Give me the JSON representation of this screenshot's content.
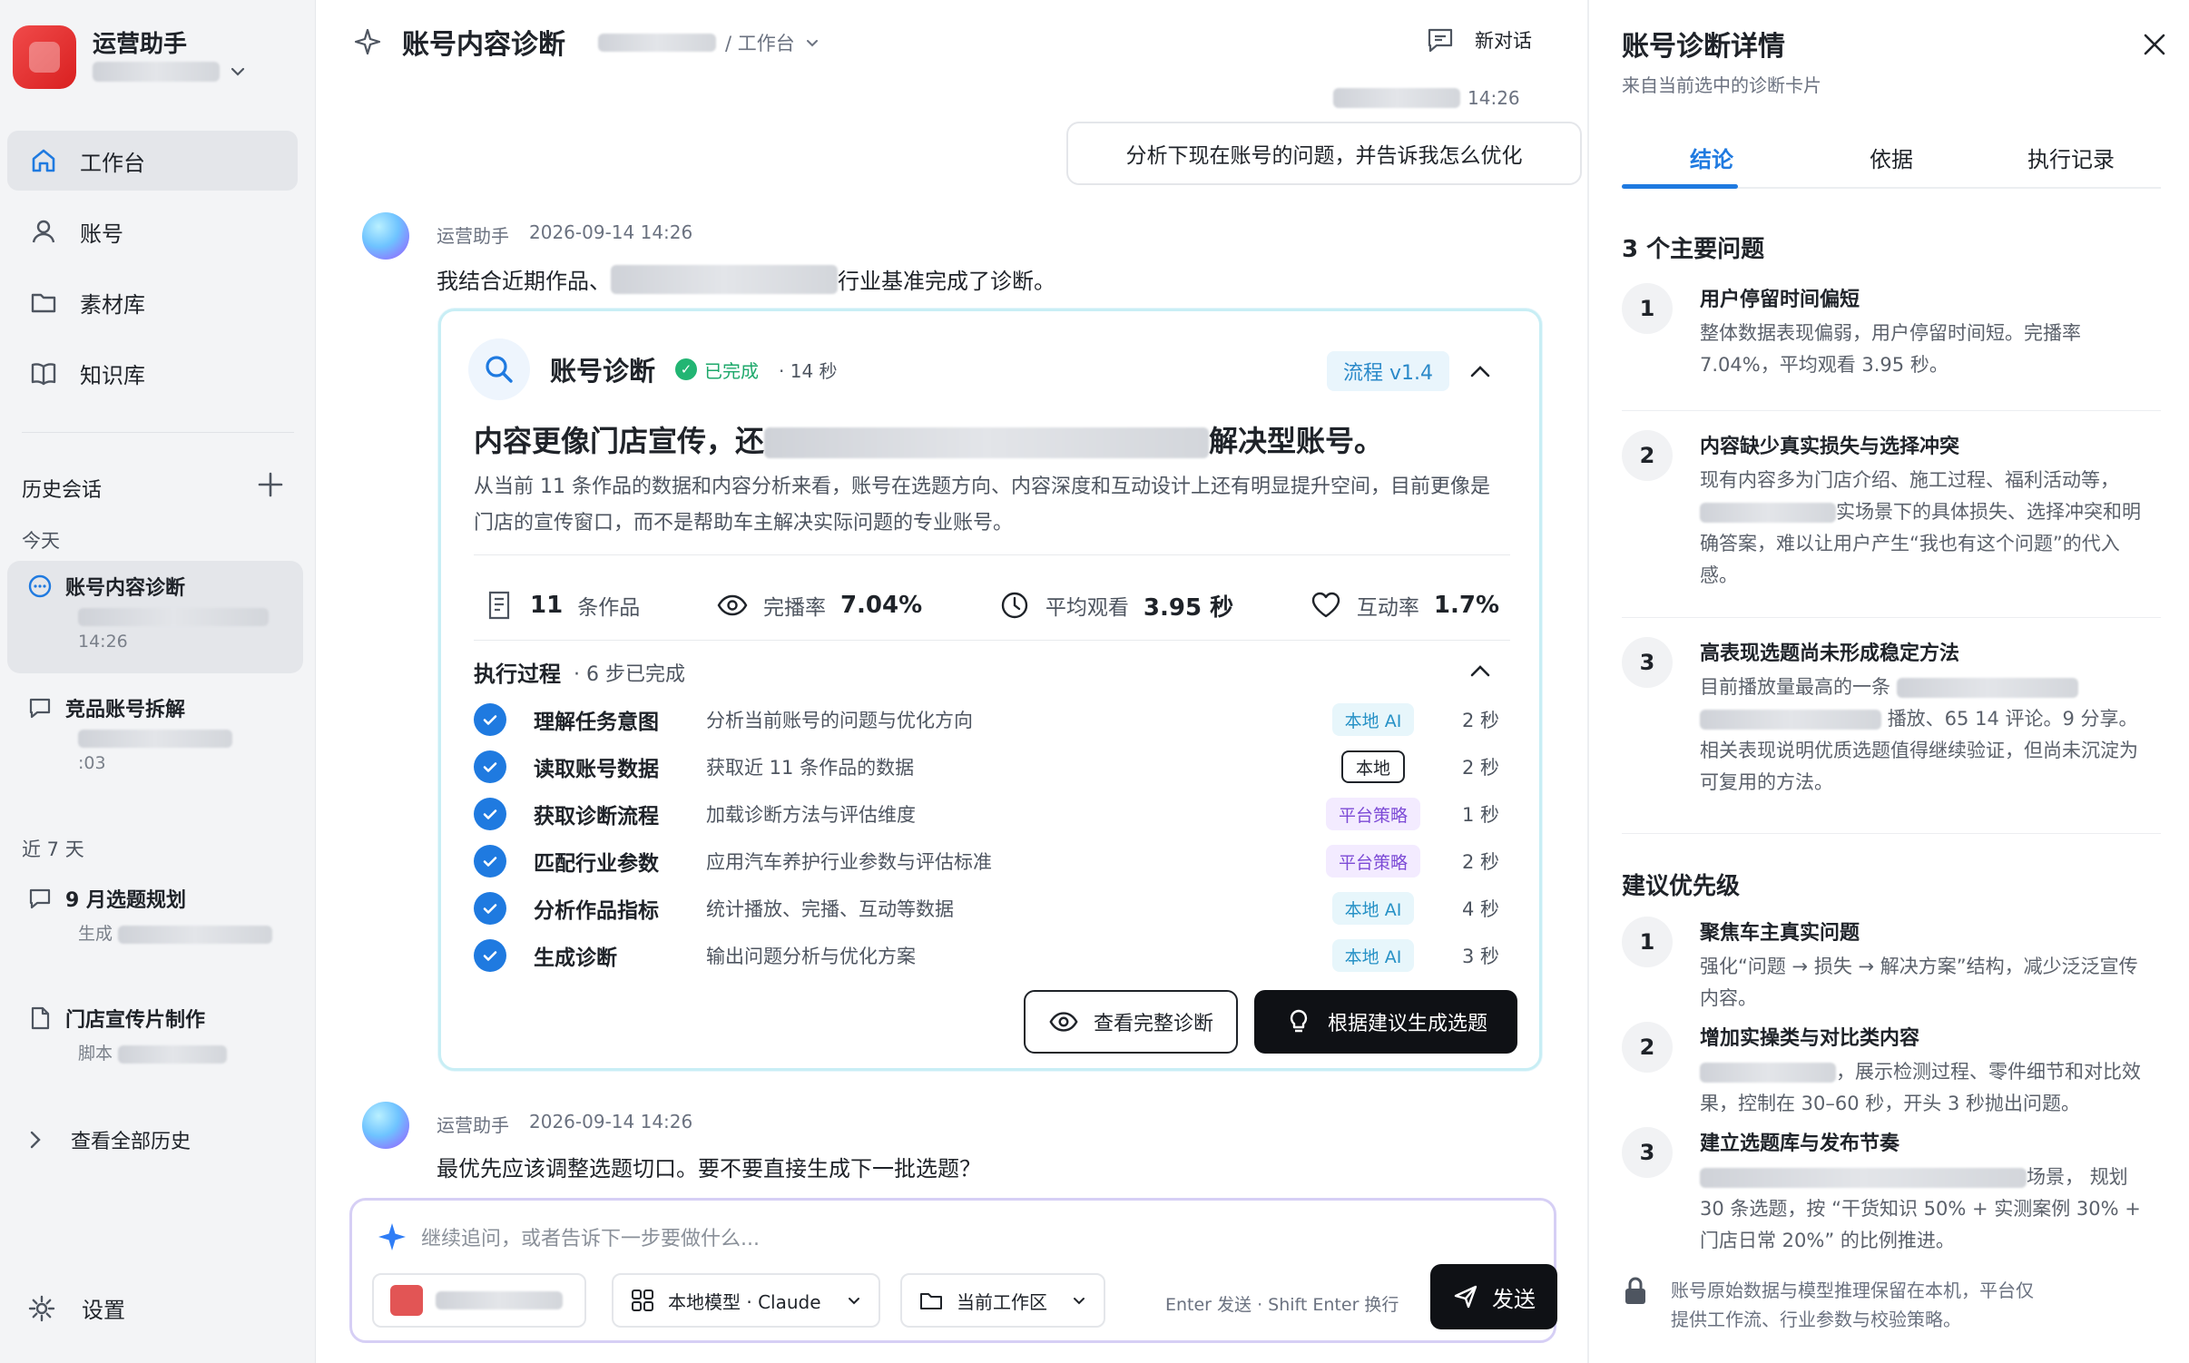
{
  "sidebar": {
    "app_name": "运营助手",
    "nav": [
      {
        "label": "工作台",
        "icon": "home-icon"
      },
      {
        "label": "账号",
        "icon": "user-icon"
      },
      {
        "label": "素材库",
        "icon": "folder-icon"
      },
      {
        "label": "知识库",
        "icon": "book-icon"
      }
    ],
    "history_label": "历史会话",
    "today_label": "今天",
    "history_today": [
      {
        "title": "账号内容诊断",
        "sub": "14:26"
      },
      {
        "title": "竞品账号拆解",
        "sub": ":03"
      }
    ],
    "week_label": "近 7 天",
    "history_week": [
      {
        "title": "9 月选题规划",
        "sub": "生成"
      },
      {
        "title": "门店宣传片制作",
        "sub": "脚本"
      }
    ],
    "view_all": "查看全部历史",
    "settings": "设置"
  },
  "main": {
    "title": "账号内容诊断",
    "breadcrumb_tail": "/ 工作台",
    "new_chat": "新对话",
    "user_time": "14:26",
    "user_message": "分析下现在账号的问题，并告诉我怎么优化",
    "assistant_name": "运营助手",
    "assistant_time": "2026-09-14 14:26",
    "assistant_intro_a": "我结合近期作品、",
    "assistant_intro_b": "行业基准完成了诊断。",
    "card": {
      "title": "账号诊断",
      "status": "已完成",
      "duration": "· 14 秒",
      "flow": "流程 v1.4",
      "headline_a": "内容更像门店宣传，还",
      "headline_b": "解决型账号。",
      "summary": "从当前 11 条作品的数据和内容分析来看，账号在选题方向、内容深度和互动设计上还有明显提升空间，目前更像是门店的宣传窗口，而不是帮助车主解决实际问题的专业账号。",
      "metrics": [
        {
          "icon": "document-icon",
          "value": "11",
          "label": "条作品"
        },
        {
          "icon": "eye-icon",
          "label": "完播率",
          "value": "7.04%"
        },
        {
          "icon": "clock-icon",
          "label": "平均观看",
          "value": "3.95 秒"
        },
        {
          "icon": "heart-icon",
          "label": "互动率",
          "value": "1.7%"
        }
      ],
      "steps_title": "执行过程",
      "steps_sub": "· 6 步已完成",
      "steps": [
        {
          "name": "理解任务意图",
          "desc": "分析当前账号的问题与优化方向",
          "tag": "本地 AI",
          "tag_type": "ai",
          "time": "2 秒"
        },
        {
          "name": "读取账号数据",
          "desc": "获取近 11 条作品的数据",
          "tag": "本地",
          "tag_type": "local",
          "time": "2 秒"
        },
        {
          "name": "获取诊断流程",
          "desc": "加载诊断方法与评估维度",
          "tag": "平台策略",
          "tag_type": "policy",
          "time": "1 秒"
        },
        {
          "name": "匹配行业参数",
          "desc": "应用汽车养护行业参数与评估标准",
          "tag": "平台策略",
          "tag_type": "policy",
          "time": "2 秒"
        },
        {
          "name": "分析作品指标",
          "desc": "统计播放、完播、互动等数据",
          "tag": "本地 AI",
          "tag_type": "ai",
          "time": "4 秒"
        },
        {
          "name": "生成诊断",
          "desc": "输出问题分析与优化方案",
          "tag": "本地 AI",
          "tag_type": "ai",
          "time": "3 秒"
        }
      ],
      "view_full": "查看完整诊断",
      "generate_topics": "根据建议生成选题"
    },
    "assistant2_name": "运营助手",
    "assistant2_time": "2026-09-14 14:26",
    "assistant2_text": "最优先应该调整选题切口。要不要直接生成下一批选题？",
    "composer": {
      "placeholder": "继续追问，或者告诉下一步要做什么...",
      "model": "本地模型 · Claude",
      "workspace": "当前工作区",
      "hint": "Enter 发送 · Shift Enter 换行",
      "send": "发送"
    }
  },
  "panel": {
    "title": "账号诊断详情",
    "subtitle": "来自当前选中的诊断卡片",
    "tabs": [
      "结论",
      "依据",
      "执行记录"
    ],
    "issues_title": "3 个主要问题",
    "issues": [
      {
        "num": "1",
        "title": "用户停留时间偏短",
        "body": "整体数据表现偏弱，用户停留时间短。完播率 7.04%，平均观看 3.95 秒。"
      },
      {
        "num": "2",
        "title": "内容缺少真实损失与选择冲突",
        "body_a": "现有内容多为门店介绍、施工过程、福利活动等，",
        "body_b": "实场景下的具体损失、选择冲突和明确答案，难以让用户产生“我也有这个问题”的代入感。"
      },
      {
        "num": "3",
        "title": "高表现选题尚未形成稳定方法",
        "body_a": "目前播放量最高的一条",
        "body_b": "播放、65",
        "body_c": "14 评论。9 分享。相关表现说明优质选题值得继续验证，但尚未沉淀为可复用的方法。"
      }
    ],
    "priority_title": "建议优先级",
    "priorities": [
      {
        "num": "1",
        "title": "聚焦车主真实问题",
        "body": "强化“问题 → 损失 → 解决方案”结构，减少泛泛宣传内容。"
      },
      {
        "num": "2",
        "title": "增加实操类与对比类内容",
        "body_a": "，展示检测过程、零件细节和对比效果，控制在 30–60 秒，开头 3 秒抛出问题。"
      },
      {
        "num": "3",
        "title": "建立选题库与发布节奏",
        "body_a": "场景，",
        "body_b": "规划 30 条选题，按 “干货知识 50% + 实测案例 30% + 门店日常 20%” 的比例推进。"
      }
    ],
    "privacy": "账号原始数据与模型推理保留在本机，平台仅提供工作流、行业参数与校验策略。"
  }
}
